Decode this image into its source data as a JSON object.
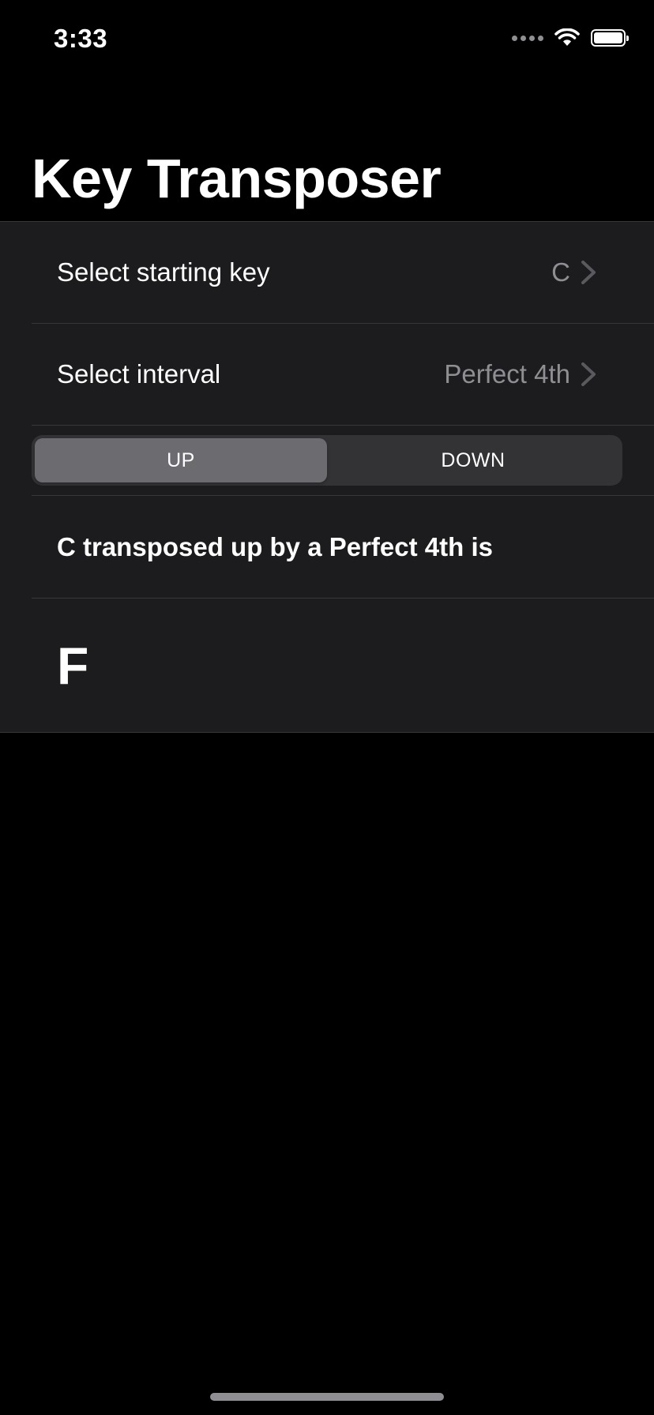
{
  "status_bar": {
    "time": "3:33"
  },
  "title": "Key Transposer",
  "rows": {
    "starting_key": {
      "label": "Select starting key",
      "value": "C"
    },
    "interval": {
      "label": "Select interval",
      "value": "Perfect 4th"
    }
  },
  "direction": {
    "options": [
      "UP",
      "DOWN"
    ],
    "selected": "UP"
  },
  "result": {
    "sentence": "C transposed up by a Perfect 4th is",
    "key": "F"
  },
  "icons": {
    "row_accessory": "chevron-right-icon",
    "status": [
      "cellular-signal-icon",
      "wifi-icon",
      "battery-icon"
    ]
  },
  "colors": {
    "background": "#000000",
    "group_background": "#1c1c1e",
    "separator": "#38383a",
    "secondary_text": "#8e8e93",
    "segment_track": "#333336",
    "segment_selected": "#6b6b70"
  }
}
